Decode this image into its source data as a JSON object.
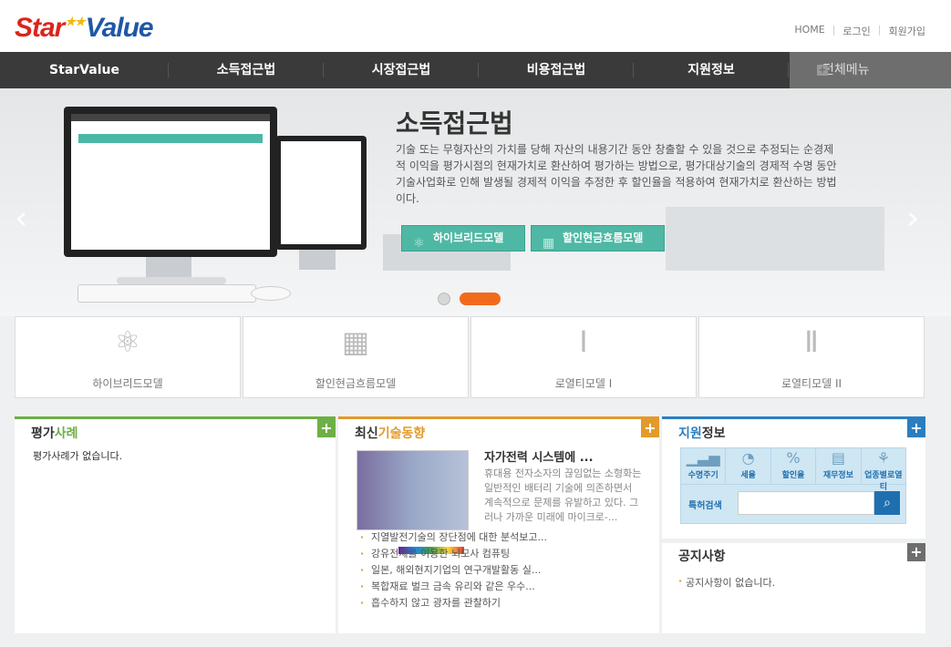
{
  "header": {
    "logo": {
      "part1": "Star",
      "part2": "Value"
    },
    "links": [
      "HOME",
      "로그인",
      "회원가입"
    ]
  },
  "nav": {
    "items": [
      "StarValue",
      "소득접근법",
      "시장접근법",
      "비용접근법",
      "지원정보"
    ],
    "all_menu": "전체메뉴"
  },
  "visual": {
    "title": "소득접근법",
    "description": "기술 또는 무형자산의 가치를 당해 자산의 내용기간 동안 창출할 수 있을 것으로 추정되는 순경제적 이익을 평가시점의 현재가치로 환산하여 평가하는 방법으로, 평가대상기술의 경제적 수명 동안 기술사업화로 인해 발생될 경제적 이익을 추정한 후 할인율을 적용하여 현재가치로 환산하는 방법이다.",
    "buttons": [
      {
        "label": "하이브리드모델",
        "icon": "atom-icon"
      },
      {
        "label": "할인현금흐름모델",
        "icon": "bricks-icon"
      }
    ],
    "slide_count": 2,
    "active_slide": 2
  },
  "models": [
    {
      "label": "하이브리드모델",
      "icon": "atom-icon"
    },
    {
      "label": "할인현금흐름모델",
      "icon": "bricks-icon"
    },
    {
      "label": "로열티모델 I",
      "icon": "medal-1-icon"
    },
    {
      "label": "로열티모델 II",
      "icon": "medal-2-icon"
    }
  ],
  "panels": {
    "cases": {
      "title_a": "평가",
      "title_b": "사례",
      "empty": "평가사례가 없습니다.",
      "color": "#6db046"
    },
    "trends": {
      "title_a": "최신",
      "title_b": "기술동향",
      "color": "#e39a2a",
      "featured_title": "자가전력 시스템에 ...",
      "featured_summary": "휴대용 전자소자의 끊임없는 소형화는 일반적인 배터리 기술에 의존하면서 계속적으로 문제를 유발하고 있다. 그러나 가까운 미래에 마이크로-...",
      "items": [
        "지열발전기술의 장단점에 대한 분석보고...",
        "강유전체를 이용한 뇌모사 컴퓨팅",
        "일본, 해외현지기업의 연구개발활동 실...",
        "복합재료 벌크 금속 유리와 같은 우수...",
        "흡수하지 않고 광자를 관찰하기"
      ]
    },
    "support": {
      "title_a": "지원",
      "title_b": "정보",
      "color": "#2a7ec0",
      "icons": [
        {
          "label": "수명주기",
          "icon": "bar-chart-icon"
        },
        {
          "label": "세율",
          "icon": "pie-chart-icon"
        },
        {
          "label": "할인율",
          "icon": "percent-icon"
        },
        {
          "label": "재무정보",
          "icon": "finance-icon"
        },
        {
          "label": "업종별로열티",
          "icon": "ribbon-icon"
        }
      ],
      "patent_label": "특허검색",
      "patent_placeholder": ""
    },
    "notice": {
      "title": "공지사항",
      "empty": "공지사항이 없습니다."
    }
  }
}
